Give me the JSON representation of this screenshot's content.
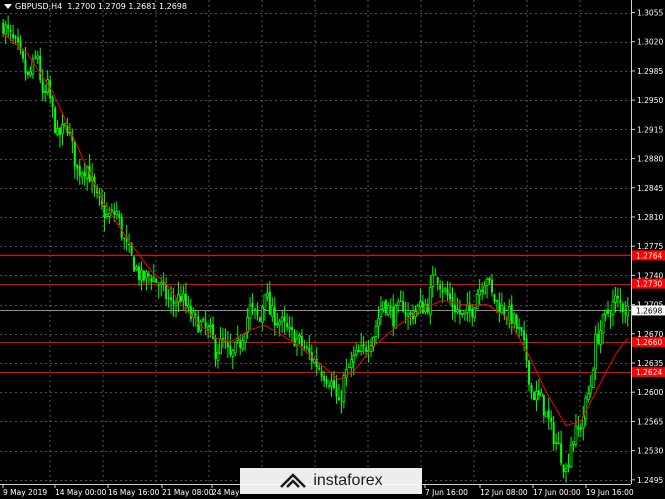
{
  "header": {
    "symbol_label": "GBPUSD,H4",
    "ohlc": "1.2700 1.2709 1.2681 1.2698"
  },
  "watermark": {
    "text": "instaforex",
    "icon": "instaforex-logo-icon"
  },
  "colors": {
    "background": "#000000",
    "candle": "#00ff00",
    "moving_average": "#ff0000",
    "level_line": "#ff0000",
    "grid": "#6b6b6b",
    "axis_text": "#ffffff",
    "price_tag": "#ff0000",
    "current_price_line": "#c0c0c0"
  },
  "chart_data": {
    "type": "candlestick",
    "ylim": [
      1.249,
      1.307
    ],
    "y_ticks": [
      "1.3055",
      "1.3020",
      "1.2985",
      "1.2950",
      "1.2915",
      "1.2880",
      "1.2845",
      "1.2810",
      "1.2775",
      "1.2740",
      "1.2705",
      "1.2670",
      "1.2635",
      "1.2600",
      "1.2565",
      "1.2530",
      "1.2495"
    ],
    "x_ticks": [
      "9 May 2019",
      "14 May 00:00",
      "16 May 16:00",
      "21 May 08:00",
      "24 May",
      "7 Jun 16:00",
      "12 Jun 08:00",
      "17 Jun 00:00",
      "19 Jun 16:00"
    ],
    "levels": [
      {
        "label": "1.2764",
        "value": 1.2764
      },
      {
        "label": "1.2730",
        "value": 1.273
      },
      {
        "label": "1.2660",
        "value": 1.266
      },
      {
        "label": "1.2624",
        "value": 1.2624
      }
    ],
    "current_price": {
      "label": "1.2698",
      "value": 1.2698
    },
    "close_path": [
      [
        0,
        1.304
      ],
      [
        6,
        1.301
      ],
      [
        10,
        1.2975
      ],
      [
        14,
        1.3005
      ],
      [
        16,
        1.295
      ],
      [
        18,
        1.2965
      ],
      [
        22,
        1.2905
      ],
      [
        26,
        1.292
      ],
      [
        30,
        1.2865
      ],
      [
        34,
        1.287
      ],
      [
        38,
        1.283
      ],
      [
        42,
        1.281
      ],
      [
        46,
        1.2815
      ],
      [
        49,
        1.278
      ],
      [
        52,
        1.276
      ],
      [
        56,
        1.2735
      ],
      [
        60,
        1.274
      ],
      [
        64,
        1.2725
      ],
      [
        68,
        1.2705
      ],
      [
        72,
        1.2715
      ],
      [
        76,
        1.269
      ],
      [
        80,
        1.268
      ],
      [
        84,
        1.267
      ],
      [
        86,
        1.265
      ],
      [
        89,
        1.266
      ],
      [
        92,
        1.264
      ],
      [
        96,
        1.266
      ],
      [
        100,
        1.27
      ],
      [
        104,
        1.2685
      ],
      [
        106,
        1.2725
      ],
      [
        108,
        1.2695
      ],
      [
        112,
        1.2685
      ],
      [
        116,
        1.267
      ],
      [
        120,
        1.266
      ],
      [
        124,
        1.2645
      ],
      [
        128,
        1.263
      ],
      [
        132,
        1.2615
      ],
      [
        134,
        1.2605
      ],
      [
        136,
        1.258
      ],
      [
        138,
        1.2615
      ],
      [
        142,
        1.264
      ],
      [
        146,
        1.265
      ],
      [
        150,
        1.267
      ],
      [
        154,
        1.271
      ],
      [
        158,
        1.269
      ],
      [
        162,
        1.2705
      ],
      [
        164,
        1.269
      ],
      [
        168,
        1.27
      ],
      [
        172,
        1.2705
      ],
      [
        175,
        1.2745
      ],
      [
        178,
        1.2725
      ],
      [
        182,
        1.2705
      ],
      [
        186,
        1.269
      ],
      [
        190,
        1.27
      ],
      [
        192,
        1.272
      ],
      [
        196,
        1.274
      ],
      [
        198,
        1.2715
      ],
      [
        202,
        1.27
      ],
      [
        206,
        1.269
      ],
      [
        210,
        1.2665
      ],
      [
        212,
        1.264
      ],
      [
        214,
        1.26
      ],
      [
        218,
        1.259
      ],
      [
        222,
        1.2555
      ],
      [
        226,
        1.2525
      ],
      [
        228,
        1.2505
      ],
      [
        230,
        1.254
      ],
      [
        234,
        1.256
      ],
      [
        238,
        1.261
      ],
      [
        240,
        1.266
      ],
      [
        244,
        1.269
      ],
      [
        248,
        1.271
      ],
      [
        252,
        1.27
      ],
      [
        253,
        1.2698
      ]
    ],
    "ma_path": [
      [
        0,
        1.303
      ],
      [
        10,
        1.3005
      ],
      [
        20,
        1.296
      ],
      [
        30,
        1.2895
      ],
      [
        40,
        1.283
      ],
      [
        50,
        1.2785
      ],
      [
        60,
        1.2745
      ],
      [
        66,
        1.273
      ],
      [
        72,
        1.2705
      ],
      [
        80,
        1.268
      ],
      [
        86,
        1.2665
      ],
      [
        92,
        1.266
      ],
      [
        100,
        1.2675
      ],
      [
        106,
        1.268
      ],
      [
        112,
        1.267
      ],
      [
        120,
        1.2655
      ],
      [
        128,
        1.2635
      ],
      [
        136,
        1.2615
      ],
      [
        142,
        1.2625
      ],
      [
        150,
        1.2655
      ],
      [
        160,
        1.268
      ],
      [
        170,
        1.27
      ],
      [
        178,
        1.271
      ],
      [
        186,
        1.2705
      ],
      [
        196,
        1.2705
      ],
      [
        204,
        1.269
      ],
      [
        212,
        1.265
      ],
      [
        220,
        1.26
      ],
      [
        228,
        1.256
      ],
      [
        234,
        1.2565
      ],
      [
        240,
        1.26
      ],
      [
        248,
        1.2645
      ],
      [
        253,
        1.2665
      ]
    ],
    "n_bars": 254,
    "seed": 7
  }
}
